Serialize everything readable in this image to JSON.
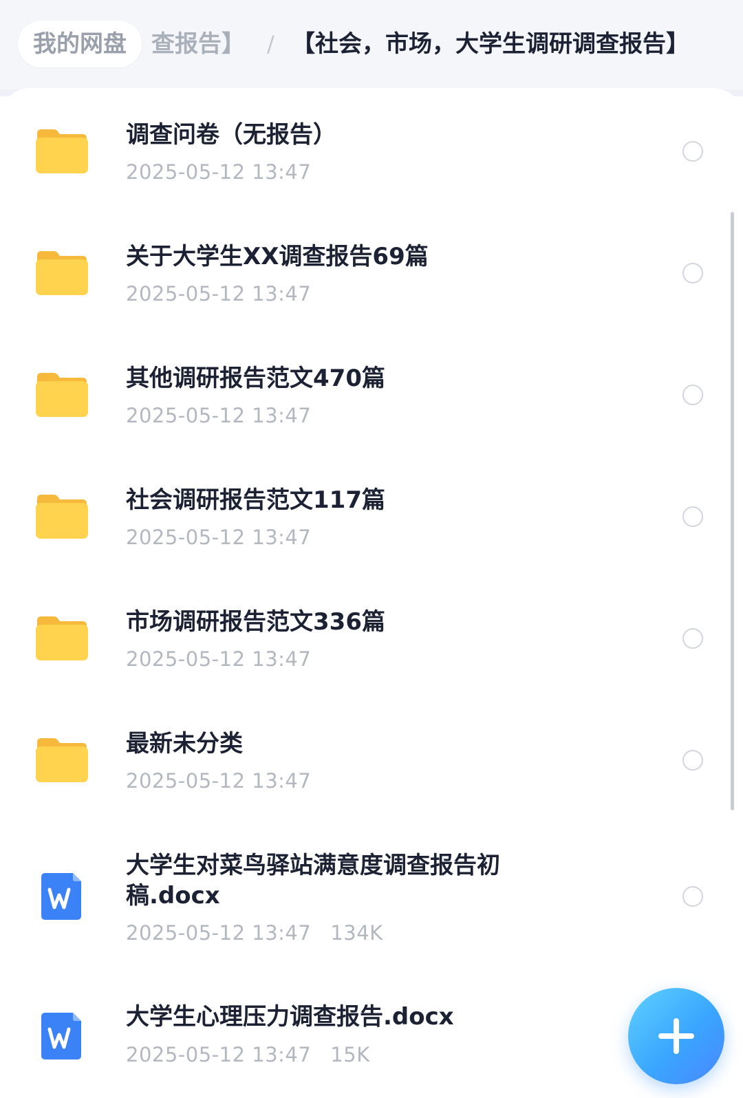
{
  "breadcrumb": {
    "home": "我的网盘",
    "previous": "查报告】",
    "separator": "/",
    "current": "【社会，市场，大学生调研调查报告】"
  },
  "items": [
    {
      "type": "folder",
      "name": "调查问卷（无报告）",
      "date": "2025-05-12 13:47",
      "size": ""
    },
    {
      "type": "folder",
      "name": "关于大学生XX调查报告69篇",
      "date": "2025-05-12 13:47",
      "size": ""
    },
    {
      "type": "folder",
      "name": "其他调研报告范文470篇",
      "date": "2025-05-12 13:47",
      "size": ""
    },
    {
      "type": "folder",
      "name": "社会调研报告范文117篇",
      "date": "2025-05-12 13:47",
      "size": ""
    },
    {
      "type": "folder",
      "name": "市场调研报告范文336篇",
      "date": "2025-05-12 13:47",
      "size": ""
    },
    {
      "type": "folder",
      "name": "最新未分类",
      "date": "2025-05-12 13:47",
      "size": ""
    },
    {
      "type": "word-doc",
      "name": "大学生对菜鸟驿站满意度调查报告初稿.docx",
      "date": "2025-05-12 13:47",
      "size": "134K"
    },
    {
      "type": "word-doc",
      "name": "大学生心理压力调查报告.docx",
      "date": "2025-05-12 13:47",
      "size": "15K"
    }
  ],
  "icons": {
    "folder": "folder-icon",
    "word_doc": "word-document-icon",
    "fab": "plus-icon"
  },
  "colors": {
    "folder": "#FFC93C",
    "word": "#3B82F6",
    "fab": "#3AA6FF",
    "title": "#1C2233",
    "meta": "#B2B7C0"
  }
}
